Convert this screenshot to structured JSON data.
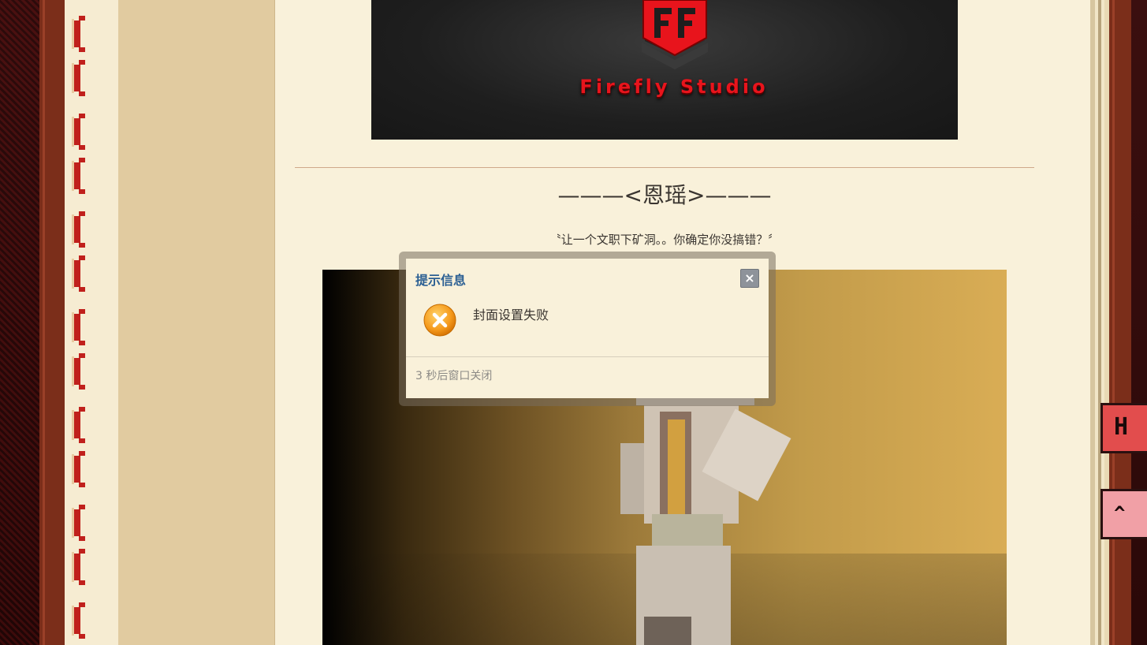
{
  "banner": {
    "studio_name": "Firefly Studio",
    "logo_icon": "firefly-studio-logo",
    "accent_color": "#e8141c"
  },
  "article": {
    "section_title": "———<恩瑶>———",
    "quote": "〝让一个文职下矿洞。。你确定你没搞错？〞",
    "image": "minecraft-character-render"
  },
  "side_buttons": [
    {
      "icon": "pixel-h-icon",
      "color": "#e24d4d"
    },
    {
      "icon": "pixel-up-arrow-icon",
      "color": "#f1a0a6"
    }
  ],
  "dialog": {
    "title": "提示信息",
    "close_icon": "close-icon",
    "status_icon": "error-icon",
    "message": "封面设置失败",
    "footer": "3 秒后窗口关闭",
    "title_color": "#2b5f93"
  }
}
